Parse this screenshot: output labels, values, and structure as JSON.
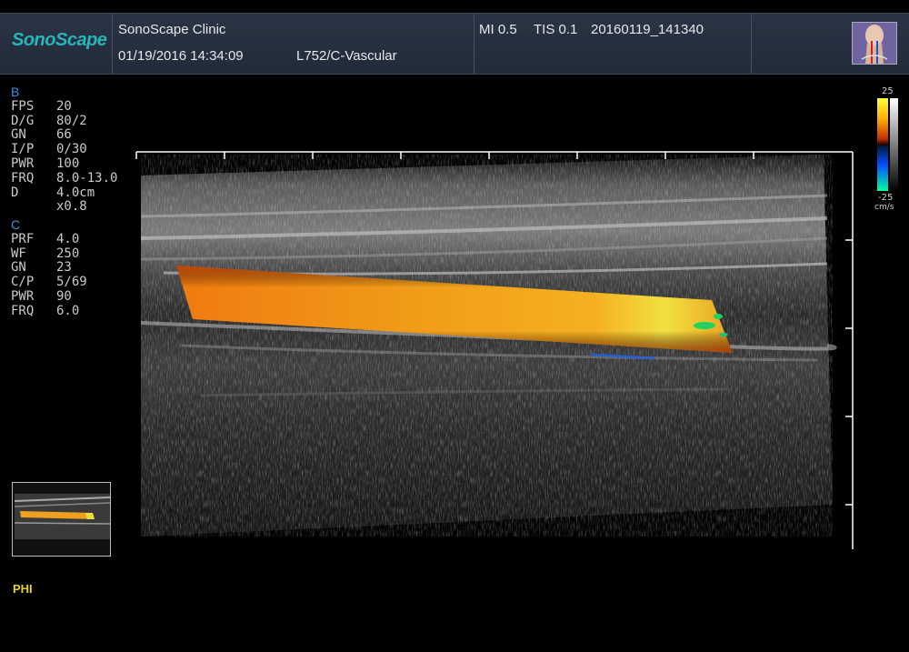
{
  "header": {
    "brand": "SonoScape",
    "clinic": "SonoScape Clinic",
    "datetime": "01/19/2016 14:34:09",
    "probe_preset": "L752/C-Vascular",
    "mi": "MI  0.5",
    "tis": "TIS 0.1",
    "exam_id": "20160119_141340",
    "body_icon": "neck-anatomy-icon"
  },
  "b_mode": {
    "title": "B",
    "params": [
      {
        "key": "FPS",
        "value": "20"
      },
      {
        "key": "D/G",
        "value": "80/2"
      },
      {
        "key": "GN",
        "value": "66"
      },
      {
        "key": "I/P",
        "value": "0/30"
      },
      {
        "key": "PWR",
        "value": "100"
      },
      {
        "key": "FRQ",
        "value": "8.0-13.0"
      },
      {
        "key": "D",
        "value": "4.0cm"
      },
      {
        "key": "",
        "value": "x0.8"
      }
    ]
  },
  "c_mode": {
    "title": "C",
    "params": [
      {
        "key": "PRF",
        "value": "4.0"
      },
      {
        "key": "WF",
        "value": "250"
      },
      {
        "key": "GN",
        "value": "23"
      },
      {
        "key": "C/P",
        "value": "5/69"
      },
      {
        "key": "PWR",
        "value": "90"
      },
      {
        "key": "FRQ",
        "value": "6.0"
      }
    ]
  },
  "color_scale": {
    "max": "25",
    "min": "-25",
    "unit": "cm/s"
  },
  "mode_label": "PHI",
  "colors": {
    "header_bg": "#232c3b",
    "brand": "#29b5b8",
    "param_title": "#3b8fe3",
    "phi_label": "#e6d520"
  }
}
